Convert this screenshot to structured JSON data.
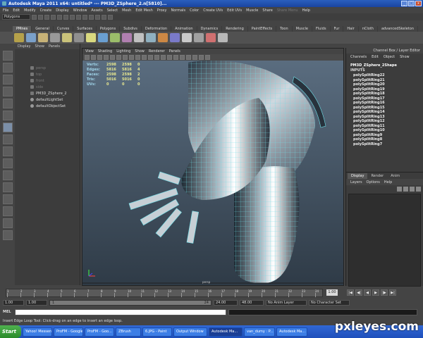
{
  "window": {
    "title": "Autodesk Maya 2011 x64: untitled*   ---   PM3D_ZSphere_2.n[5810]...",
    "btn_min": "_",
    "btn_max": "□",
    "btn_close": "x"
  },
  "menubar": {
    "items": [
      "File",
      "Edit",
      "Modify",
      "Create",
      "Display",
      "Window",
      "Assets",
      "Select",
      "Mesh",
      "Edit Mesh",
      "Proxy",
      "Normals",
      "Color",
      "Create UVs",
      "Edit UVs",
      "Muscle",
      "Share",
      "Share Menu",
      "Help"
    ]
  },
  "statusline": {
    "mode": "Polygons"
  },
  "shelf": {
    "tabs": [
      "PMnes",
      "General",
      "Curves",
      "Surfaces",
      "Polygons",
      "Subdivs",
      "Deformation",
      "Animation",
      "Dynamics",
      "Rendering",
      "PaintEffects",
      "Toon",
      "Muscle",
      "Fluids",
      "Fur",
      "Hair",
      "nCloth",
      "advancedSkeleton"
    ],
    "active_tab": "PMnes"
  },
  "outliner": {
    "menu": [
      "Display",
      "Show",
      "Panels"
    ],
    "items": [
      {
        "label": "persp",
        "dim": true
      },
      {
        "label": "top",
        "dim": true
      },
      {
        "label": "front",
        "dim": true
      },
      {
        "label": "side",
        "dim": true
      },
      {
        "label": "PM3D_ZSphere_2",
        "dim": false
      },
      {
        "label": "defaultLightSet",
        "dim": false
      },
      {
        "label": "defaultObjectSet",
        "dim": false
      }
    ]
  },
  "viewport": {
    "menu": [
      "View",
      "Shading",
      "Lighting",
      "Show",
      "Renderer",
      "Panels"
    ],
    "hud": [
      {
        "label": "Verts:",
        "a": "2598",
        "b": "2598",
        "c": "0"
      },
      {
        "label": "Edges:",
        "a": "5816",
        "b": "5816",
        "c": "4"
      },
      {
        "label": "Faces:",
        "a": "2598",
        "b": "2598",
        "c": "2"
      },
      {
        "label": "Tris:",
        "a": "5016",
        "b": "5016",
        "c": "0"
      },
      {
        "label": "UVs:",
        "a": "0",
        "b": "0",
        "c": "0"
      }
    ],
    "camera_label": "persp"
  },
  "channelbox": {
    "header": "Channel Box / Layer Editor",
    "menu": [
      "Channels",
      "Edit",
      "Object",
      "Show"
    ],
    "node": "PM3D_ZSphere_2Shape",
    "inputs_label": "INPUTS",
    "inputs": [
      "polySplitRing22",
      "polySplitRing21",
      "polySplitRing20",
      "polySplitRing19",
      "polySplitRing18",
      "polySplitRing17",
      "polySplitRing16",
      "polySplitRing15",
      "polySplitRing14",
      "polySplitRing13",
      "polySplitRing12",
      "polySplitRing11",
      "polySplitRing10",
      "polySplitRing9",
      "polySplitRing8",
      "polySplitRing7"
    ]
  },
  "layers": {
    "tabs": [
      "Display",
      "Render",
      "Anim"
    ],
    "active_tab": "Display",
    "menu": [
      "Layers",
      "Options",
      "Help"
    ]
  },
  "timeslider": {
    "ticks": [
      "1",
      "2",
      "3",
      "4",
      "5",
      "6",
      "7",
      "8",
      "9",
      "10",
      "11",
      "12",
      "13",
      "14",
      "15",
      "16",
      "17",
      "18",
      "19",
      "20",
      "21",
      "22",
      "23",
      "24"
    ],
    "current": "1.00",
    "buttons": [
      "|◀",
      "◀|",
      "◀",
      "▶",
      "|▶",
      "▶|"
    ]
  },
  "range": {
    "start": "1.00",
    "start2": "1.00",
    "bar_left": "1",
    "bar_right": "24",
    "end": "24.00",
    "end2": "48.00",
    "anim_layer": "No Anim Layer",
    "character_set": "No Character Set"
  },
  "mel": {
    "label": "MEL"
  },
  "help": {
    "text": "Insert Edge Loop Tool: Click-drag on an edge to insert an edge loop."
  },
  "taskbar": {
    "start": "Start",
    "items": [
      {
        "label": "Yahoo! Messen...",
        "active": false
      },
      {
        "label": "ProFM - Google...",
        "active": false
      },
      {
        "label": "ProFM - Goo...",
        "active": false
      },
      {
        "label": "ZBrush",
        "active": false
      },
      {
        "label": "6.JPG - Paint",
        "active": false
      },
      {
        "label": "Output Window",
        "active": false
      },
      {
        "label": "Autodesk Ma...",
        "active": true
      },
      {
        "label": "van_dumy : P...",
        "active": false
      },
      {
        "label": "Autodesk Ma...",
        "active": false
      }
    ]
  },
  "watermark": "pxleyes.com"
}
